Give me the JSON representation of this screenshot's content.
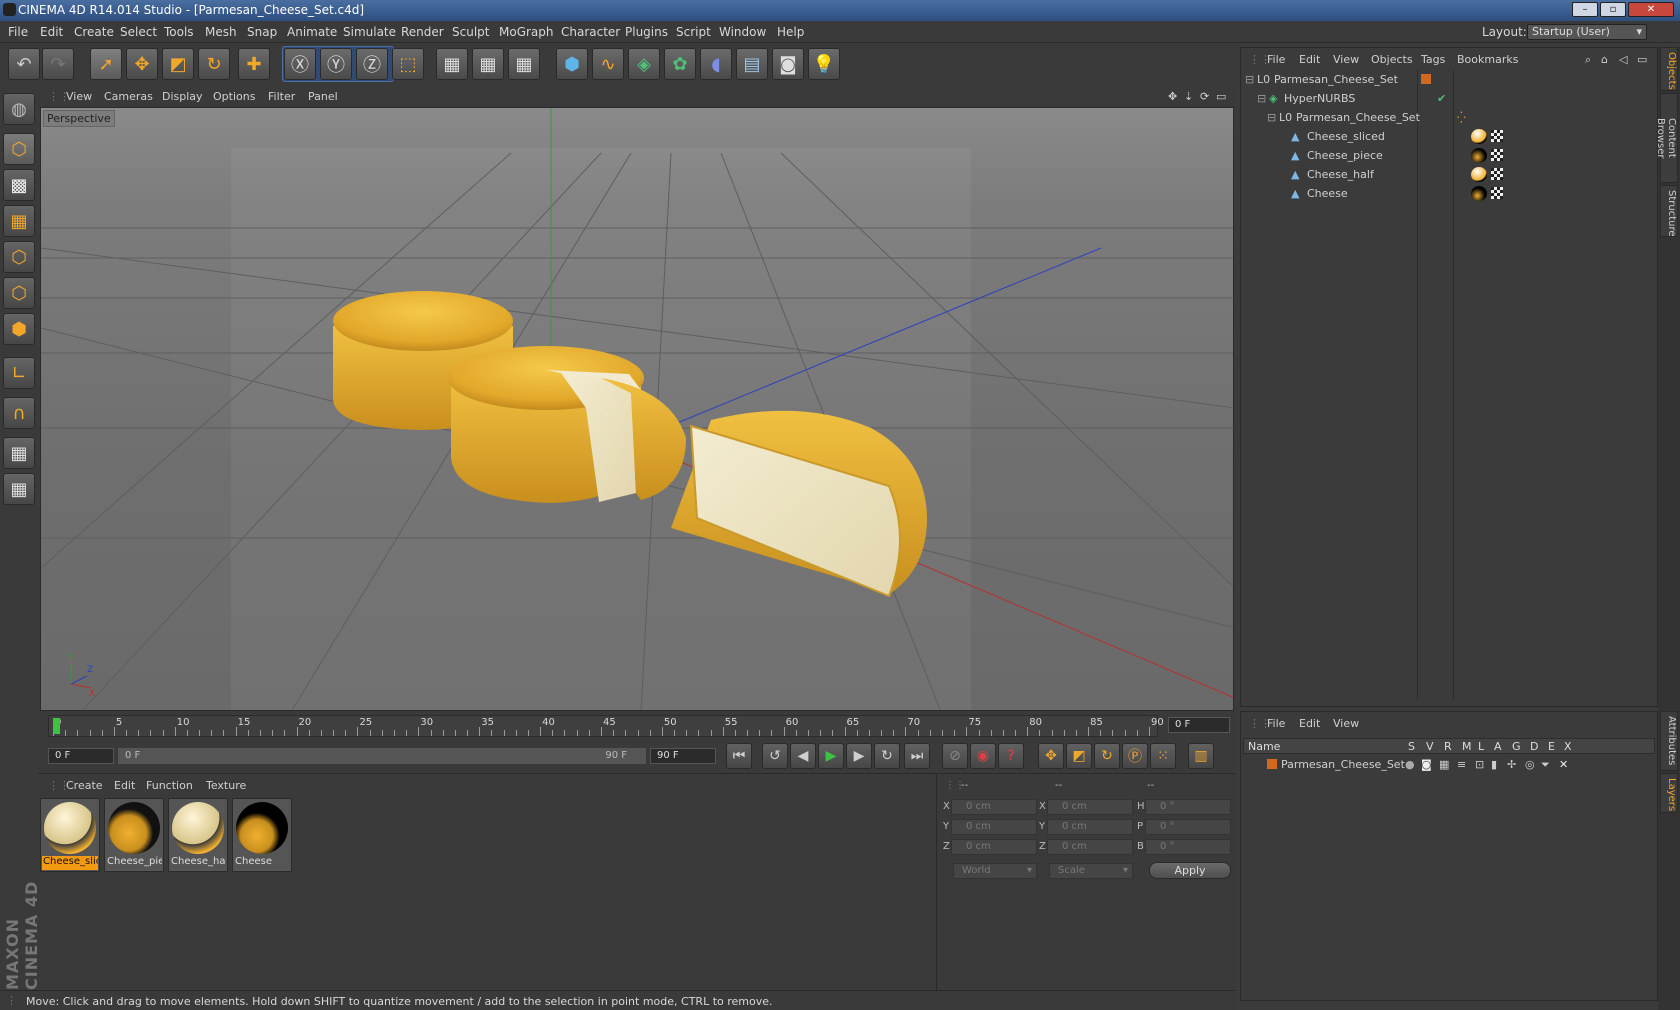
{
  "window": {
    "title": "CINEMA 4D R14.014 Studio - [Parmesan_Cheese_Set.c4d]",
    "controls": [
      "–",
      "▫",
      "✕"
    ]
  },
  "menubar": {
    "items": [
      "File",
      "Edit",
      "Create",
      "Select",
      "Tools",
      "Mesh",
      "Snap",
      "Animate",
      "Simulate",
      "Render",
      "Sculpt",
      "MoGraph",
      "Character",
      "Plugins",
      "Script",
      "Window",
      "Help"
    ],
    "layout_label": "Layout:",
    "layout_value": "Startup (User)"
  },
  "viewport": {
    "menu": [
      "View",
      "Cameras",
      "Display",
      "Options",
      "Filter",
      "Panel"
    ],
    "label": "Perspective"
  },
  "timeline": {
    "ticks": [
      "0",
      "5",
      "10",
      "15",
      "20",
      "25",
      "30",
      "35",
      "40",
      "45",
      "50",
      "55",
      "60",
      "65",
      "70",
      "75",
      "80",
      "85",
      "90"
    ],
    "current": "0 F"
  },
  "transport": {
    "start_field": "0 F",
    "range_start": "0 F",
    "range_end": "90 F",
    "end_field": "90 F"
  },
  "material_manager": {
    "menu": [
      "Create",
      "Edit",
      "Function",
      "Texture"
    ],
    "materials": [
      {
        "name": "Cheese_sliced",
        "selected": true
      },
      {
        "name": "Cheese_piece",
        "selected": false
      },
      {
        "name": "Cheese_half",
        "selected": false
      },
      {
        "name": "Cheese",
        "selected": false
      }
    ]
  },
  "coordinates": {
    "header": [
      "--",
      "--",
      "--"
    ],
    "rows": [
      {
        "a": "X",
        "av": "0 cm",
        "b": "X",
        "bv": "0 cm",
        "c": "H",
        "cv": "0 °"
      },
      {
        "a": "Y",
        "av": "0 cm",
        "b": "Y",
        "bv": "0 cm",
        "c": "P",
        "cv": "0 °"
      },
      {
        "a": "Z",
        "av": "0 cm",
        "b": "Z",
        "bv": "0 cm",
        "c": "B",
        "cv": "0 °"
      }
    ],
    "space": "World",
    "mode": "Scale",
    "apply": "Apply"
  },
  "object_manager": {
    "menu": [
      "File",
      "Edit",
      "View",
      "Objects",
      "Tags",
      "Bookmarks"
    ],
    "objects": [
      {
        "name": "Parmesan_Cheese_Set",
        "level": 0
      },
      {
        "name": "HyperNURBS",
        "level": 1
      },
      {
        "name": "Parmesan_Cheese_Set",
        "level": 2
      },
      {
        "name": "Cheese_sliced",
        "level": 3
      },
      {
        "name": "Cheese_piece",
        "level": 3
      },
      {
        "name": "Cheese_half",
        "level": 3
      },
      {
        "name": "Cheese",
        "level": 3
      }
    ]
  },
  "layer_manager": {
    "menu": [
      "File",
      "Edit",
      "View"
    ],
    "columns": [
      "Name",
      "S",
      "V",
      "R",
      "M",
      "L",
      "A",
      "G",
      "D",
      "E",
      "X"
    ],
    "layers": [
      {
        "name": "Parmesan_Cheese_Set",
        "color": "#d2691e"
      }
    ]
  },
  "side_tabs": [
    "Objects",
    "Content Browser",
    "Structure",
    "Attributes",
    "Layers"
  ],
  "status": "Move: Click and drag to move elements. Hold down SHIFT to quantize movement / add to the selection in point mode, CTRL to remove.",
  "branding": "MAXON CINEMA 4D"
}
